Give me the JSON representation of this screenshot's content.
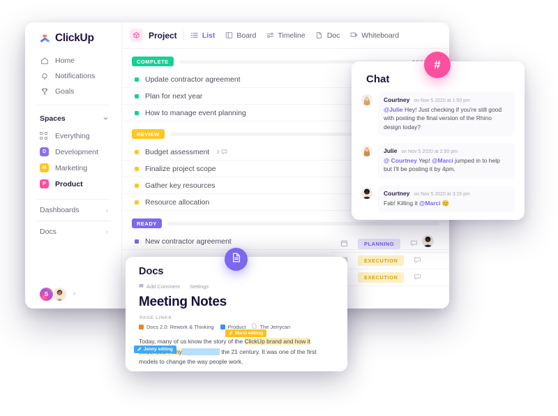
{
  "brand": {
    "name": "ClickUp",
    "accent": "#7b68ee",
    "pink": "#fb4fa0"
  },
  "sidebar": {
    "nav": [
      {
        "label": "Home",
        "icon": "home-icon"
      },
      {
        "label": "Notifications",
        "icon": "bell-icon"
      },
      {
        "label": "Goals",
        "icon": "trophy-icon"
      }
    ],
    "spaces_header": {
      "label": "Spaces",
      "icon": "chevron-down-icon"
    },
    "spaces": [
      {
        "label": "Everything",
        "icon": "grid-dots-icon",
        "badge": "",
        "color": ""
      },
      {
        "label": "Development",
        "badge": "D",
        "color": "#8b6ff0"
      },
      {
        "label": "Marketing",
        "badge": "M",
        "color": "#ffc61f"
      },
      {
        "label": "Product",
        "badge": "P",
        "color": "#fb4fa0",
        "active": true
      }
    ],
    "footer": [
      {
        "label": "Dashboards",
        "icon": "chevron-right-icon"
      },
      {
        "label": "Docs",
        "icon": "chevron-right-icon"
      }
    ],
    "user_avatar_initial": "S",
    "add_member_icon": "plus-icon"
  },
  "toolbar": {
    "project_icon": "cube-icon",
    "project_name": "Project",
    "views": [
      {
        "label": "List",
        "icon": "list-icon",
        "active": true
      },
      {
        "label": "Board",
        "icon": "board-icon",
        "active": false
      },
      {
        "label": "Timeline",
        "icon": "timeline-icon",
        "active": false
      },
      {
        "label": "Doc",
        "icon": "doc-icon",
        "active": false
      },
      {
        "label": "Whiteboard",
        "icon": "whiteboard-icon",
        "active": false
      }
    ]
  },
  "list": {
    "assignee_column_label": "ASSIGNEE",
    "groups": [
      {
        "status": "COMPLETE",
        "status_color": "#19cf95",
        "dot_color": "#19cf95",
        "tasks": [
          {
            "name": "Update contractor agreement"
          },
          {
            "name": "Plan for next year"
          },
          {
            "name": "How to manage event planning"
          }
        ]
      },
      {
        "status": "REVIEW",
        "status_color": "#ffc61f",
        "dot_color": "#ffc61f",
        "tasks": [
          {
            "name": "Budget assessment",
            "comments": "3",
            "comment_icon": "comment-icon"
          },
          {
            "name": "Finalize project scope"
          },
          {
            "name": "Gather key resources"
          },
          {
            "name": "Resource allocation"
          }
        ]
      },
      {
        "status": "READY",
        "status_color": "#7b68ee",
        "dot_color": "#7b68ee",
        "tasks": [
          {
            "name": "New contractor agreement"
          }
        ]
      }
    ],
    "side_rows": [
      {
        "date_icon": "calendar-icon",
        "tag": "PLANNING",
        "tag_bg": "#e6e2fb",
        "tag_fg": "#6f5ce0",
        "comment_icon": "comment-icon"
      },
      {
        "date_icon": "calendar-icon",
        "tag": "EXECUTION",
        "tag_bg": "#fdf0c3",
        "tag_fg": "#d9a216",
        "comment_icon": "comment-icon"
      },
      {
        "date_icon": "calendar-icon",
        "tag": "EXECUTION",
        "tag_bg": "#fdf0c3",
        "tag_fg": "#d9a216",
        "comment_icon": "comment-icon"
      }
    ]
  },
  "chat": {
    "title": "Chat",
    "hash_badge": "#",
    "messages": [
      {
        "author": "Courtney",
        "time": "on Nov 5 2020 at 1:50 pm",
        "mention": "@Julie",
        "text": " Hey! Just checking if you're still good with posting the final version of the Rhino design today?"
      },
      {
        "author": "Julie",
        "time": "on Nov 5 2020 at 2:50 pm",
        "mention": "@ Courtney",
        "text": " Yep! ",
        "mention2": "@Marci",
        "text2": " jumped in to help but I'll be posting it by 4pm."
      },
      {
        "author": "Courtney",
        "time": "on Nov 5 2020 at 3:15 pm",
        "text_pre": "Fab! Killing it ",
        "mention": "@Marci",
        "emoji": "😊"
      }
    ]
  },
  "docs": {
    "panel_title": "Docs",
    "fab_icon": "document-icon",
    "tools": [
      {
        "label": "Add Comment",
        "icon": "comment-square-icon"
      },
      {
        "label": "Settings",
        "icon": ""
      }
    ],
    "doc_title": "Meeting Notes",
    "page_links_label": "PAGE LINKS",
    "page_links": [
      {
        "label": "Docs 2.0: Rework & Thinking",
        "color": "#f5801f"
      },
      {
        "label": "Product",
        "color": "#3e8ef0"
      },
      {
        "label": "The Jerrycan",
        "color": "#cfcfd8"
      }
    ],
    "body": {
      "part1": "Today, many of us know the story of the ",
      "highlight1": "ClickUp brand and how it influenced many",
      "part2": " the 21 century. It was one of the first models  to change the way people work.",
      "cursors": [
        {
          "name": "Marci editing",
          "color": "#ffc01f",
          "icon": "pencil-icon"
        },
        {
          "name": "Jenny editing",
          "color": "#41a7f5",
          "icon": "pencil-icon"
        }
      ]
    }
  }
}
